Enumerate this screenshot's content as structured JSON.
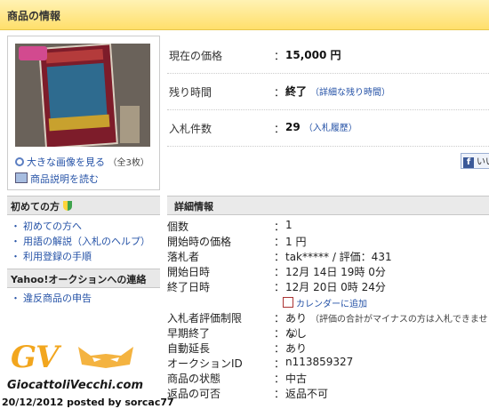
{
  "header": {
    "title": "商品の情報"
  },
  "image_panel": {
    "large_image_link": "大きな画像を見る",
    "image_count": "（全3枚）",
    "description_link": "商品説明を読む"
  },
  "summary": [
    {
      "label": "現在の価格",
      "colon": "：",
      "value": "15,000 円",
      "sub": ""
    },
    {
      "label": "残り時間",
      "colon": "：",
      "value": "終了",
      "sub": "（詳細な残り時間）"
    },
    {
      "label": "入札件数",
      "colon": "：",
      "value": "29",
      "sub": "（入札履歴）"
    }
  ],
  "facebook": {
    "label": "いい"
  },
  "sidebar": {
    "first_time": {
      "title": "初めての方",
      "items": [
        "初めての方へ",
        "用語の解説（入札のヘルプ）",
        "利用登録の手順"
      ]
    },
    "contact": {
      "title": "Yahoo!オークションへの連絡",
      "items": [
        "違反商品の申告"
      ]
    }
  },
  "details": {
    "title": "詳細情報",
    "rows": [
      {
        "label": "個数",
        "value": "1",
        "note": ""
      },
      {
        "label": "開始時の価格",
        "value": "1 円",
        "note": ""
      },
      {
        "label": "落札者",
        "value": "tak***** / 評価：431",
        "note": ""
      },
      {
        "label": "開始日時",
        "value": "12月 14日 19時 0分",
        "note": ""
      },
      {
        "label": "終了日時",
        "value": "12月 20日 0時 24分",
        "note": ""
      },
      {
        "label": "入札者評価制限",
        "value": "あり",
        "note": "（評価の合計がマイナスの方は入札できません）"
      },
      {
        "label": "早期終了",
        "value": "なし",
        "note": ""
      },
      {
        "label": "自動延長",
        "value": "あり",
        "note": ""
      },
      {
        "label": "オークションID",
        "value": "n113859327",
        "note": ""
      },
      {
        "label": "商品の状態",
        "value": "中古",
        "note": ""
      },
      {
        "label": "返品の可否",
        "value": "返品不可",
        "note": ""
      }
    ],
    "calendar_link": "カレンダーに追加"
  },
  "watermark": {
    "logo": "GV",
    "site": "GiocattoliVecchi.com"
  },
  "credit": "20/12/2012 posted by sorcac77",
  "colors": {
    "header_bg": "#ffdf6b",
    "link": "#2653a7",
    "brand_orange": "#f2a61e"
  }
}
